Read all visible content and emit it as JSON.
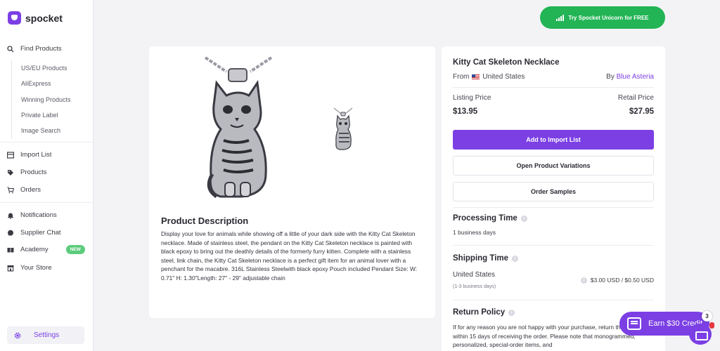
{
  "brand": {
    "name": "spocket"
  },
  "sidebar": {
    "find_products": "Find Products",
    "sub_items": [
      "US/EU Products",
      "AliExpress",
      "Winning Products",
      "Private Label",
      "Image Search"
    ],
    "import_list": "Import List",
    "products": "Products",
    "orders": "Orders",
    "notifications": "Notifications",
    "supplier_chat": "Supplier Chat",
    "academy": "Academy",
    "academy_badge": "NEW",
    "your_store": "Your Store",
    "settings": "Settings"
  },
  "header": {
    "trial_button": "Try Spocket Unicorn for FREE"
  },
  "product": {
    "title": "Kitty Cat Skeleton Necklace",
    "from_label": "From",
    "country": "United States",
    "by_label": "By",
    "supplier": "Blue Asteria",
    "listing_price_label": "Listing Price",
    "listing_price": "$13.95",
    "retail_price_label": "Retail Price",
    "retail_price": "$27.95",
    "add_button": "Add to Import List",
    "variations_button": "Open Product Variations",
    "samples_button": "Order Samples",
    "description_title": "Product Description",
    "description": "Display your love for animals while showing off a little of your dark side with the Kitty Cat Skeleton necklace. Made of stainless steel, the pendant on the Kitty Cat Skeleton necklace is painted with black epoxy to bring out the deathly details of the formerly furry kitten. Complete with a stainless steel, link chain, the Kitty Cat Skeleton necklace is a perfect gift item for an animal lover with a penchant for the macabre. 316L Stainless Steelwith black epoxy Pouch included Pendant Size: W: 0.71\" H: 1.30\"Length: 27\" - 29\" adjustable chain"
  },
  "processing": {
    "title": "Processing Time",
    "value": "1 business days"
  },
  "shipping": {
    "title": "Shipping Time",
    "country": "United States",
    "days": "(1-3 business days)",
    "cost": "$3.00 USD / $0.50 USD"
  },
  "returns": {
    "title": "Return Policy",
    "text": "If for any reason you are not happy with your purchase, return the item(s) within 15 days of receiving the order. Please note that monogrammed, personalized, special-order items, and"
  },
  "earn": {
    "label": "Earn $30 Credit",
    "count": "3"
  },
  "colors": {
    "accent": "#7b3fe4",
    "green": "#22b455"
  }
}
